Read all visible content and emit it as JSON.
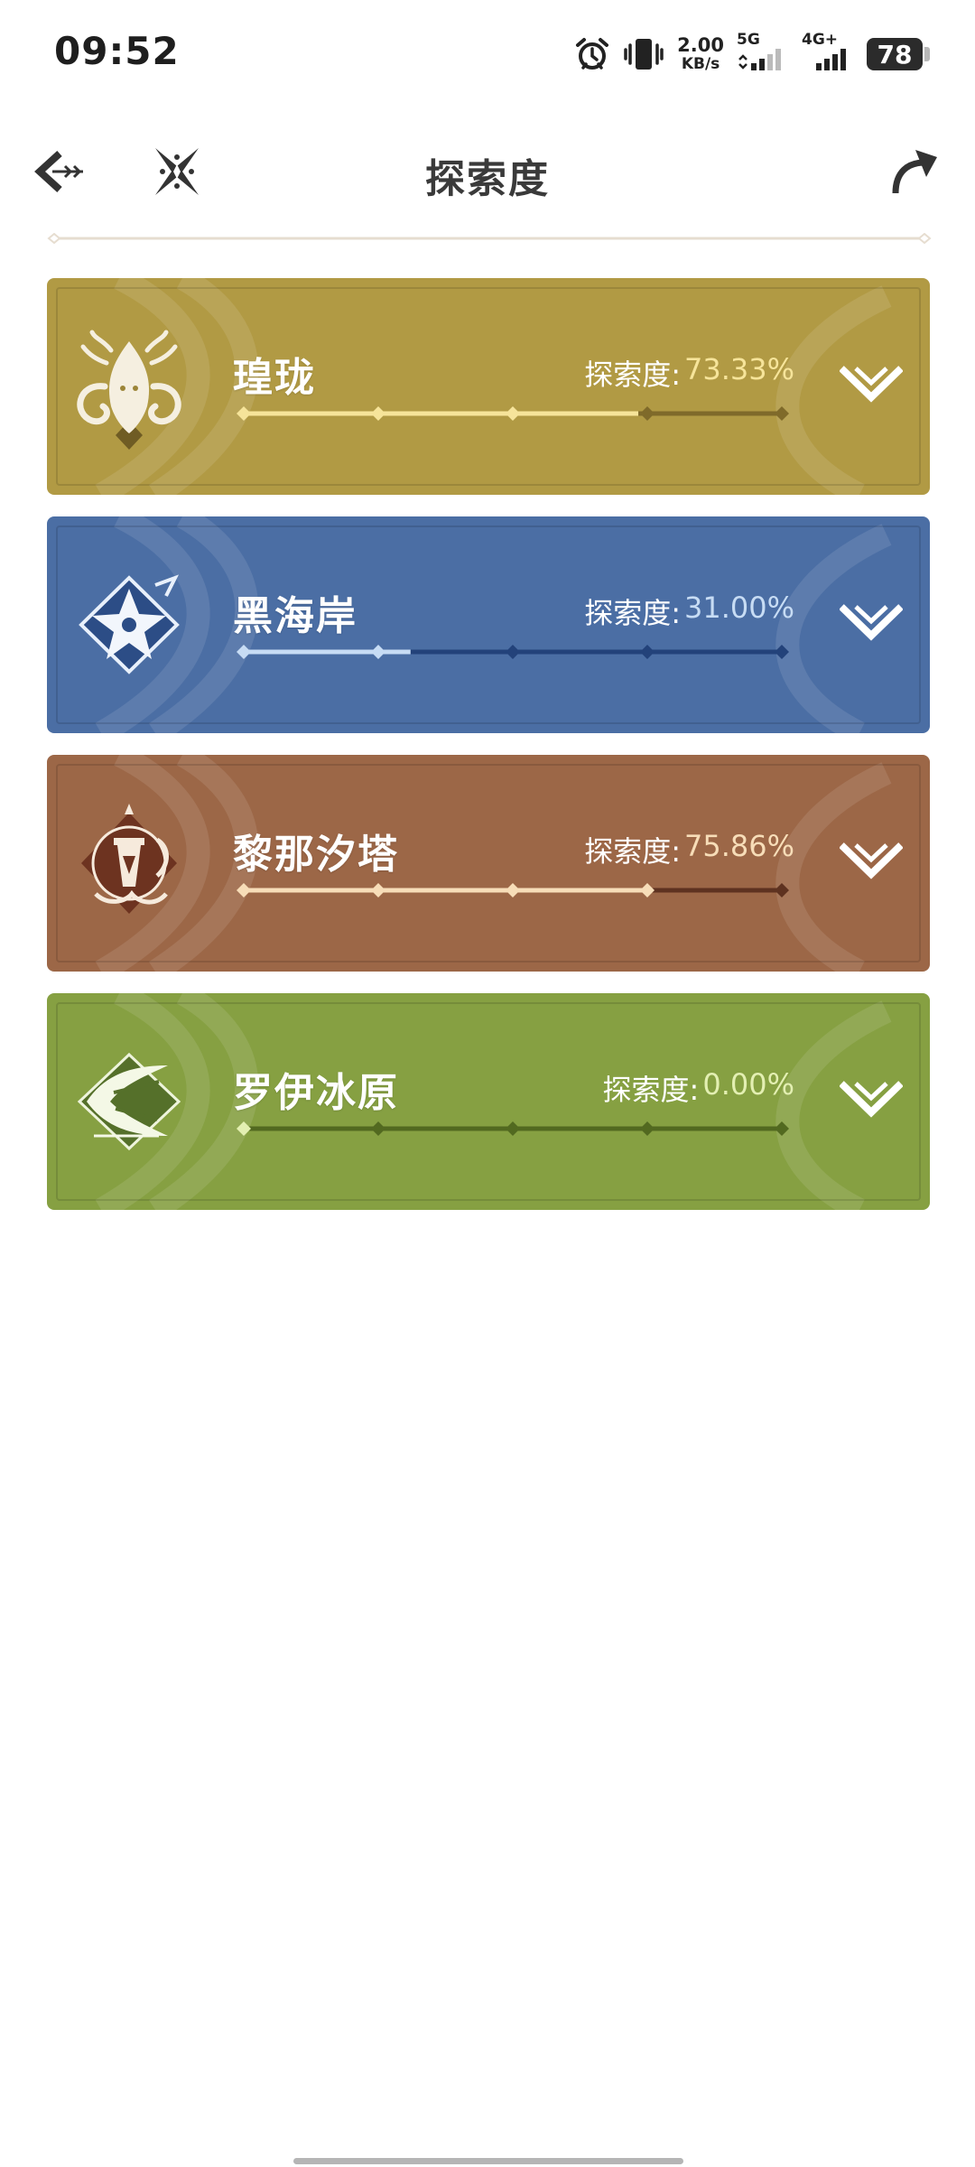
{
  "status_bar": {
    "time": "09:52",
    "net_speed_value": "2.00",
    "net_speed_unit": "KB/s",
    "sim1_label": "5G",
    "sim2_label": "4G+",
    "battery": "78",
    "icons": [
      "alarm-icon",
      "vibrate-icon",
      "signal-icon",
      "battery-icon"
    ]
  },
  "header": {
    "title": "探索度",
    "back_icon": "back-arrow-icon",
    "close_icon": "close-sparkle-icon",
    "share_icon": "share-arrow-icon"
  },
  "regions": [
    {
      "name": "瑝珑",
      "label": "探索度:",
      "percent": "73.33%",
      "value": 73.33,
      "bg": "#b19a44",
      "fill": "#f6e49a",
      "track": "#7f6a2a",
      "pct_color": "#f6e49a",
      "emblem": "dragon-emblem-icon"
    },
    {
      "name": "黑海岸",
      "label": "探索度:",
      "percent": "31.00%",
      "value": 31.0,
      "bg": "#4b6ea4",
      "fill": "#c7dcf4",
      "track": "#23427a",
      "pct_color": "#c7dcf4",
      "emblem": "star-flower-emblem-icon"
    },
    {
      "name": "黎那汐塔",
      "label": "探索度:",
      "percent": "75.86%",
      "value": 75.86,
      "bg": "#9c6747",
      "fill": "#f7ddb8",
      "track": "#5e3220",
      "pct_color": "#f7ddb8",
      "emblem": "bell-tower-emblem-icon"
    },
    {
      "name": "罗伊冰原",
      "label": "探索度:",
      "percent": "0.00%",
      "value": 0.0,
      "bg": "#86a042",
      "fill": "#e3efb2",
      "track": "#526920",
      "pct_color": "#e3efb2",
      "emblem": "ice-blade-emblem-icon"
    }
  ]
}
